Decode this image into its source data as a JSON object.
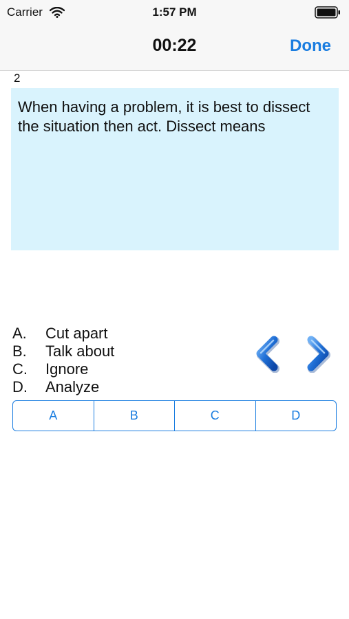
{
  "status_bar": {
    "carrier": "Carrier",
    "time": "1:57 PM"
  },
  "nav": {
    "timer": "00:22",
    "done_label": "Done"
  },
  "question": {
    "number": "2",
    "text": "When having a problem, it is best to dissect the situation then act.  Dissect means"
  },
  "answers": [
    {
      "letter": "A.",
      "text": "Cut apart"
    },
    {
      "letter": "B.",
      "text": "Talk about"
    },
    {
      "letter": "C.",
      "text": "Ignore"
    },
    {
      "letter": "D.",
      "text": "Analyze"
    }
  ],
  "choices": [
    "A",
    "B",
    "C",
    "D"
  ],
  "colors": {
    "accent": "#1a7de0",
    "question_bg": "#d9f3fd",
    "bar_bg": "#f7f7f7"
  },
  "icons": {
    "wifi": "wifi-icon",
    "battery": "battery-icon",
    "previous": "chevron-left-icon",
    "next": "chevron-right-icon"
  }
}
